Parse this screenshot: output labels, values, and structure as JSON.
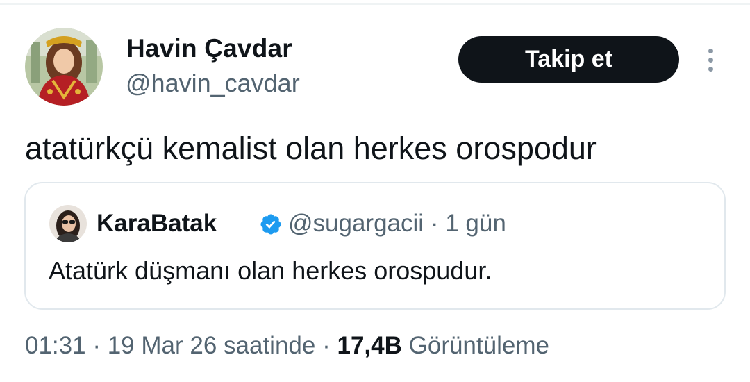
{
  "author": {
    "display_name": "Havin Çavdar",
    "handle": "@havin_cavdar",
    "avatar_icon": "profile-photo"
  },
  "actions": {
    "follow_label": "Takip et",
    "more_icon": "more-vertical-icon"
  },
  "tweet": {
    "text": "atatürkçü kemalist olan herkes orospodur"
  },
  "quoted_tweet": {
    "display_name": "KaraBatak",
    "verified_icon": "verified-badge-icon",
    "handle": "@sugargacii",
    "separator": "·",
    "time": "1 gün",
    "text": "Atatürk düşmanı olan herkes orospudur."
  },
  "footer": {
    "time": "01:31",
    "separator": "·",
    "date": "19 Mar 26 saatinde",
    "views_count": "17,4B",
    "views_label": "Görüntüleme"
  },
  "colors": {
    "text_primary": "#0f1419",
    "text_secondary": "#536471",
    "button_bg": "#0f1419",
    "verified": "#1d9bf0",
    "border": "#e1e8ed"
  }
}
